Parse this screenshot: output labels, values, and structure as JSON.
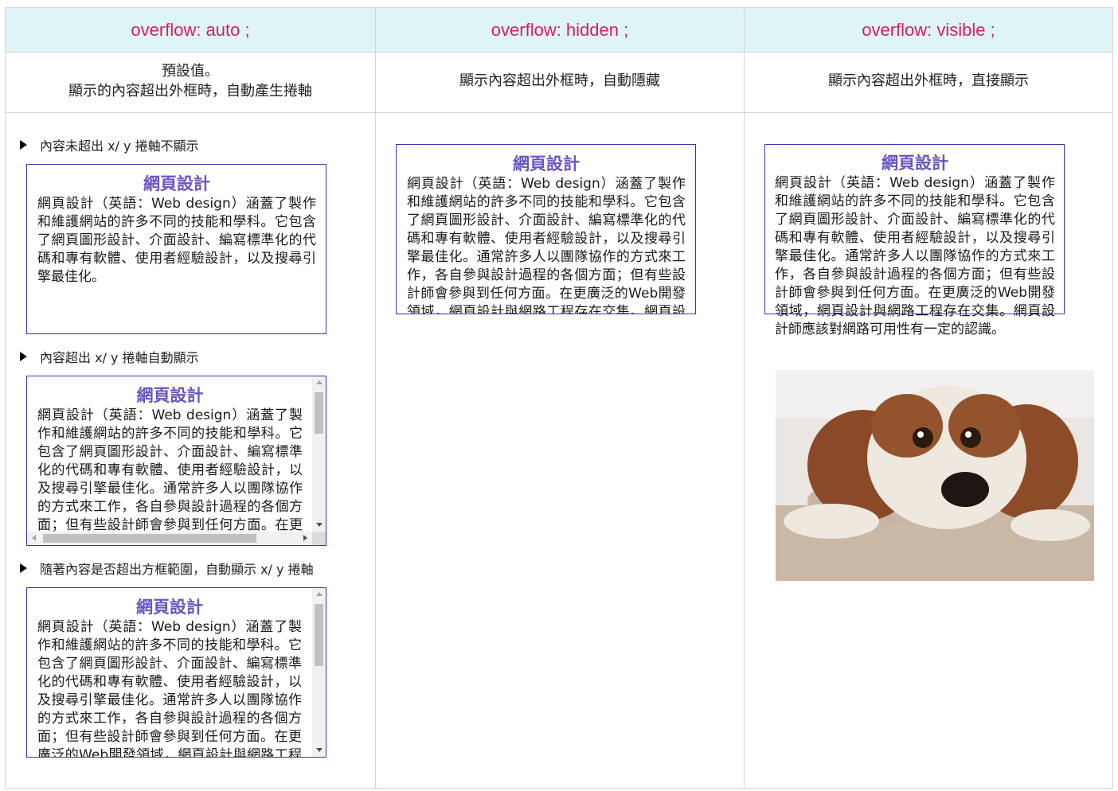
{
  "headers": {
    "auto": "overflow: auto ;",
    "hidden": "overflow: hidden ;",
    "visible": "overflow: visible ;"
  },
  "descriptions": {
    "auto": "預設值。\n顯示的內容超出外框時，自動產生捲軸",
    "hidden": "顯示內容超出外框時，自動隱藏",
    "visible": "顯示內容超出外框時，直接顯示"
  },
  "auto_section": {
    "bullets": [
      "內容未超出 x/ y 捲軸不顯示",
      "內容超出 x/ y 捲軸自動顯示",
      "隨著內容是否超出方框範圍，自動顯示 x/ y 捲軸"
    ],
    "short_text": "網頁設計（英語：Web design）涵蓋了製作和維護網站的許多不同的技能和學科。它包含了網頁圖形設計、介面設計、編寫標準化的代碼和專有軟體、使用者經驗設計，以及搜尋引擎最佳化。"
  },
  "box": {
    "title": "網頁設計",
    "text": "網頁設計（英語：Web design）涵蓋了製作和維護網站的許多不同的技能和學科。它包含了網頁圖形設計、介面設計、編寫標準化的代碼和專有軟體、使用者經驗設計，以及搜尋引擎最佳化。通常許多人以團隊協作的方式來工作，各自參與設計過程的各個方面；但有些設計師會參與到任何方面。在更廣泛的Web開發領域，網頁設計與網路工程存在交集。網頁設計師應該對網路可用性有一定的認識。"
  },
  "image": {
    "subject": "puppy-photo"
  },
  "colors": {
    "header_bg": "#dff4f6",
    "header_text": "#d4205e",
    "box_border": "#3a36a8",
    "box_title": "#6a55c0"
  }
}
